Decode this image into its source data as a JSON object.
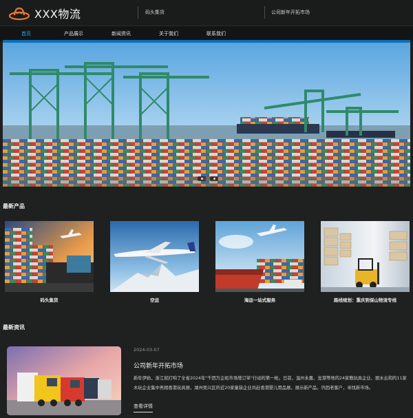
{
  "header": {
    "brand_title": "XXX物流",
    "links": [
      "码头集货",
      "公司新年开拓市场"
    ]
  },
  "nav": {
    "items": [
      {
        "label": "首页",
        "active": true
      },
      {
        "label": "产品展示",
        "active": false
      },
      {
        "label": "新闻资讯",
        "active": false
      },
      {
        "label": "关于我们",
        "active": false
      },
      {
        "label": "联系我们",
        "active": false
      }
    ]
  },
  "banner": {
    "image": "container-port-with-cranes",
    "slide_count": 2,
    "current_slide": 1
  },
  "products": {
    "title": "最新产品",
    "items": [
      {
        "caption": "码头集货",
        "image": "port-containers-airplane"
      },
      {
        "caption": "空运",
        "image": "airplane-over-snow-mountain"
      },
      {
        "caption": "海运一站式服务",
        "image": "cargo-ship-airplane"
      },
      {
        "caption": "路线规划：重庆到保山物流专线",
        "image": "warehouse-forklift"
      }
    ]
  },
  "news": {
    "title": "最新资讯",
    "items": [
      {
        "date": "2024-03-07",
        "title": "公司新年开拓市场",
        "summary": "新年伊始，浙江就打响了全省2024年\"千团万企拓市场增订单\"行动的第一枪。日前，温州永嘉、龙港等地的24家教玩具企业、丽水云和的11家木玩企业集中亮相香港玩具展，湖州吴兴区的近20家童装企业共赴香港婴儿用品展，展示新产品，巩固老客户，寻找新市场。",
        "more_label": "查看详情",
        "image": "trucks-on-road"
      }
    ]
  },
  "colors": {
    "accent": "#0d6fb8",
    "active_nav": "#33a4ff",
    "background": "#1f2020",
    "logo": "#e8772e"
  }
}
